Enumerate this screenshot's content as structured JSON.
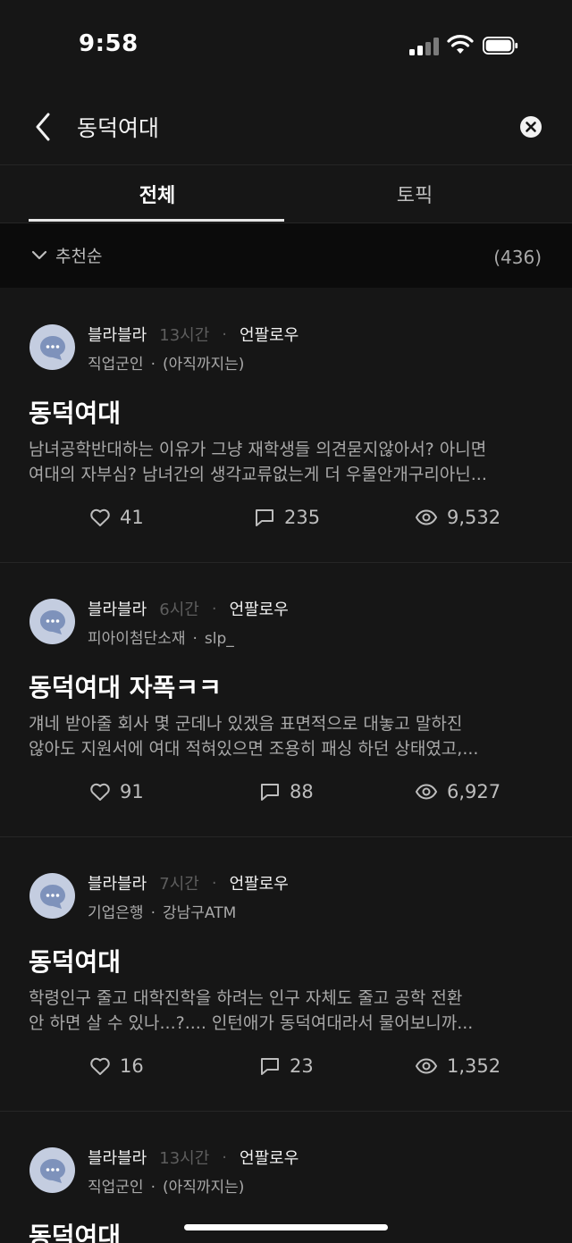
{
  "status_bar": {
    "time": "9:58"
  },
  "search": {
    "query": "동덕여대"
  },
  "tabs": [
    {
      "label": "전체",
      "active": true
    },
    {
      "label": "토픽",
      "active": false
    }
  ],
  "sort": {
    "label": "추천순",
    "count": "(436)"
  },
  "icons": {
    "back": "chevron-left-icon",
    "clear": "clear-circle-icon",
    "like": "heart-icon",
    "comment": "comment-icon",
    "view": "eye-icon"
  },
  "posts": [
    {
      "author": "블라블라",
      "time": "13시간",
      "follow": "언팔로우",
      "company": "직업군인",
      "nickname": "(아직까지는)",
      "title": "동덕여대",
      "excerpt1": "남녀공학반대하는 이유가 그냥 재학생들 의견묻지않아서? 아니면",
      "excerpt2": "여대의 자부심? 남녀간의 생각교류없는게 더 우물안개구리아닌...",
      "likes": "41",
      "comments": "235",
      "views": "9,532"
    },
    {
      "author": "블라블라",
      "time": "6시간",
      "follow": "언팔로우",
      "company": "피아이첨단소재",
      "nickname": "slp_",
      "title": "동덕여대 자폭ㅋㅋ",
      "excerpt1": "걔네 받아줄 회사 몇 군데나 있겠음 표면적으로 대놓고 말하진",
      "excerpt2": "않아도 지원서에 여대 적혀있으면 조용히 패싱 하던 상태였고,...",
      "likes": "91",
      "comments": "88",
      "views": "6,927"
    },
    {
      "author": "블라블라",
      "time": "7시간",
      "follow": "언팔로우",
      "company": "기업은행",
      "nickname": "강남구ATM",
      "title": "동덕여대",
      "excerpt1": "학령인구 줄고  대학진학을 하려는 인구 자체도 줄고  공학 전환",
      "excerpt2": "안 하면 살 수 있나...?....  인턴애가 동덕여대라서 물어보니까...",
      "likes": "16",
      "comments": "23",
      "views": "1,352"
    },
    {
      "author": "블라블라",
      "time": "13시간",
      "follow": "언팔로우",
      "company": "직업군인",
      "nickname": "(아직까지는)",
      "title": "동덕여대"
    }
  ]
}
